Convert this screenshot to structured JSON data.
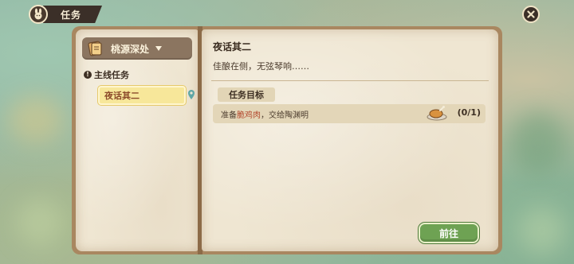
{
  "header": {
    "title": "任务",
    "icon": "rabbit-icon",
    "close_icon": "close-icon"
  },
  "left_page": {
    "region_selector": {
      "label": "桃源深处",
      "icon": "book-icon"
    },
    "section": {
      "label": "主线任务",
      "icon": "alert-icon"
    },
    "quests": [
      {
        "label": "夜话其二",
        "selected": true
      }
    ],
    "location_icon": "map-pin-icon"
  },
  "right_page": {
    "title": "夜话其二",
    "description": "佳酿在侧，无弦琴响……",
    "objective_header": "任务目标",
    "objective": {
      "prefix": "准备",
      "item": "脆鸡肉",
      "suffix": "，交给陶渊明",
      "progress": "(0/1)",
      "item_icon": "roast-chicken-icon"
    },
    "action_button": "前往"
  },
  "colors": {
    "accent_green": "#6ea253",
    "highlight_text": "#b2472c",
    "selected_item": "#f7e79a",
    "book_cover": "#a98760"
  }
}
